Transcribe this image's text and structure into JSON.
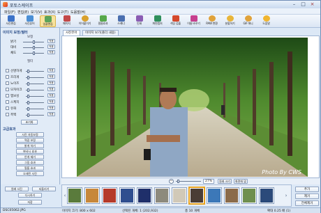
{
  "window": {
    "title": "포토스케이프",
    "controls": [
      "–",
      "□",
      "×"
    ]
  },
  "menu": [
    "파일(F)",
    "편집(E)",
    "보기(V)",
    "효과(X)",
    "도구(T)",
    "도움말(H)"
  ],
  "toolbar": [
    {
      "label": "사진편집",
      "icon": "photo-edit-icon",
      "color": "#3d73c9"
    },
    {
      "label": "사진뷰어",
      "icon": "viewer-icon",
      "color": "#4b8fd6"
    },
    {
      "label": "일괄편집",
      "icon": "batch-edit-icon",
      "color": "#5ba35a"
    },
    {
      "label": "페이지",
      "icon": "page-icon",
      "color": "#c34848"
    },
    {
      "label": "이어붙이기",
      "icon": "combine-icon",
      "color": "#d9a12e"
    },
    {
      "label": "필름효과",
      "icon": "film-effect-icon",
      "color": "#57a84b"
    },
    {
      "label": "스캐너",
      "icon": "scanner-icon",
      "color": "#4b6fb0"
    },
    {
      "label": "인쇄",
      "icon": "print-icon",
      "color": "#8a5cb3"
    },
    {
      "label": "화면캡처",
      "icon": "capture-icon",
      "color": "#2f8f5c"
    },
    {
      "label": "색상 검출",
      "icon": "color-picker-icon",
      "color": "#d4492c"
    },
    {
      "label": "이름 바꾸기",
      "icon": "rename-icon",
      "color": "#c63f8e"
    },
    {
      "label": "RAW 변환",
      "icon": "raw-icon",
      "color": "#e0a23a"
    },
    {
      "label": "분할하기",
      "icon": "split-icon",
      "color": "#e8b53a"
    },
    {
      "label": "GIF 애니",
      "icon": "gif-icon",
      "color": "#e0a23a"
    },
    {
      "label": "도움말",
      "icon": "help-icon",
      "color": "#f0b530"
    }
  ],
  "left_panel": {
    "section_title": "이미지 보정/필터",
    "basic_title": "보정",
    "basic_rows": [
      {
        "label": "밝기",
        "button": "적용"
      },
      {
        "label": "대비",
        "button": "적용"
      },
      {
        "label": "채도",
        "button": "적용"
      }
    ],
    "filter_title": "필터",
    "filter_rows": [
      {
        "label": "선명하게",
        "button": "적용"
      },
      {
        "label": "흐리게",
        "button": "적용"
      },
      {
        "label": "노이즈",
        "button": "적용"
      },
      {
        "label": "모자이크",
        "button": "적용"
      },
      {
        "label": "엠보싱",
        "button": "적용"
      },
      {
        "label": "스케치",
        "button": "적용"
      },
      {
        "label": "유화",
        "button": "적용"
      },
      {
        "label": "흑백",
        "button": "적용"
      }
    ],
    "reset_button": "초기화",
    "advanced_title": "고급효과",
    "advanced_buttons": [
      "사진 자동보정",
      "역광 보정",
      "밝게 하기",
      "뽀샤시 효과",
      "안개 제거",
      "그림 효과",
      "필름 효과",
      "오래된 사진"
    ],
    "bottom_buttons": [
      "원래 사진",
      "되돌리기",
      "다시하기",
      "저장"
    ]
  },
  "tabs": [
    "사진뷰어",
    "이미지 보기(폴더 내용)"
  ],
  "photo": {
    "watermark": "Photo By CWS"
  },
  "viewbar": {
    "zoom": "27%",
    "buttons": [
      "원래 크기",
      "화면에 맞춤"
    ]
  },
  "filmstrip": {
    "thumbs": [
      {
        "color": "#5a7b3c"
      },
      {
        "color": "#c7873a"
      },
      {
        "color": "#b53a2a"
      },
      {
        "color": "#2f4e8f"
      },
      {
        "color": "#1f2f6a"
      },
      {
        "color": "#8d8a7d"
      },
      {
        "color": "#d1c9b8"
      },
      {
        "color": "#4a3d35"
      },
      {
        "color": "#3c78b8"
      },
      {
        "color": "#8b6b4a"
      },
      {
        "color": "#6f8f4f"
      },
      {
        "color": "#2b4a7a"
      },
      {
        "color": "#d9b36a"
      }
    ],
    "selected_index": 7
  },
  "side_buttons": [
    "추가",
    "제거",
    "전체제거"
  ],
  "status": {
    "file": "DSC05062.JPG",
    "dimensions": "이미지 크기: 800 x 602",
    "selection": "선택된 개체: 1 (202,932)",
    "count": "총 10 개체",
    "zoom": "확대 0.25 배 (1)"
  }
}
